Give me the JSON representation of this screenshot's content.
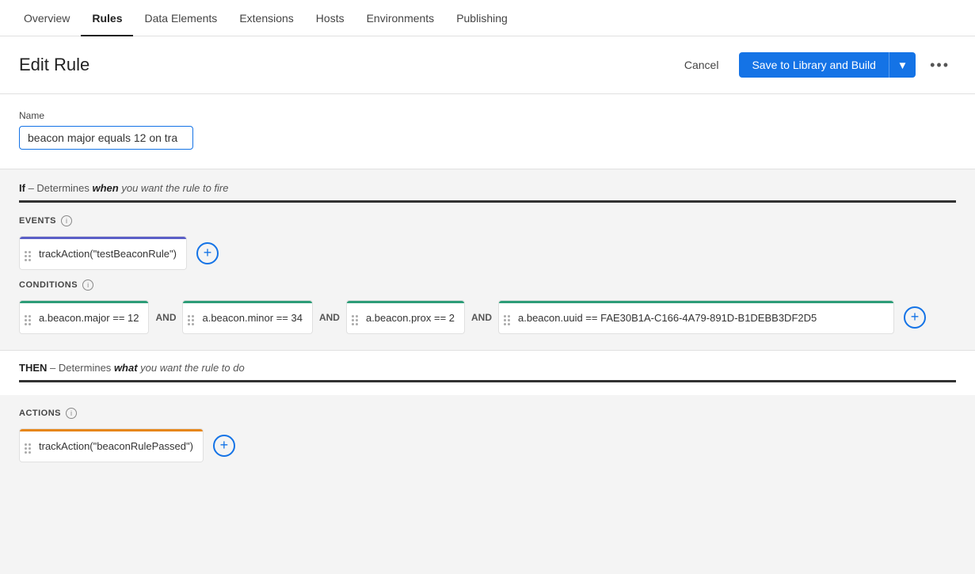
{
  "nav": {
    "items": [
      {
        "label": "Overview",
        "active": false
      },
      {
        "label": "Rules",
        "active": true
      },
      {
        "label": "Data Elements",
        "active": false
      },
      {
        "label": "Extensions",
        "active": false
      },
      {
        "label": "Hosts",
        "active": false
      },
      {
        "label": "Environments",
        "active": false
      },
      {
        "label": "Publishing",
        "active": false
      }
    ]
  },
  "header": {
    "title": "Edit Rule",
    "cancel_label": "Cancel",
    "save_label": "Save to Library and Build",
    "more_icon": "⋯"
  },
  "name_section": {
    "field_label": "Name",
    "name_value": "beacon major equals 12 on tra"
  },
  "if_section": {
    "prefix": "If",
    "description_part1": " – Determines ",
    "when_keyword": "when",
    "description_part2": " you want the rule to fire"
  },
  "events": {
    "label": "EVENTS",
    "cards": [
      {
        "text": "trackAction(\"testBeaconRule\")",
        "bar_color": "blue"
      }
    ]
  },
  "conditions": {
    "label": "CONDITIONS",
    "cards": [
      {
        "text": "a.beacon.major == 12",
        "bar_color": "green"
      },
      {
        "text": "a.beacon.minor == 34",
        "bar_color": "green"
      },
      {
        "text": "a.beacon.prox == 2",
        "bar_color": "green"
      },
      {
        "text": "a.beacon.uuid == FAE30B1A-C166-4A79-891D-B1DEBB3DF2D5",
        "bar_color": "green"
      }
    ],
    "and_label": "AND"
  },
  "then_section": {
    "prefix": "THEN",
    "description_part1": " – Determines ",
    "what_keyword": "what",
    "description_part2": " you want the rule to do"
  },
  "actions": {
    "label": "ACTIONS",
    "cards": [
      {
        "text": "trackAction(\"beaconRulePassed\")",
        "bar_color": "yellow"
      }
    ]
  },
  "icons": {
    "drag": "⠿",
    "info": "i",
    "add": "+",
    "chevron_down": "▾",
    "more": "•••"
  }
}
